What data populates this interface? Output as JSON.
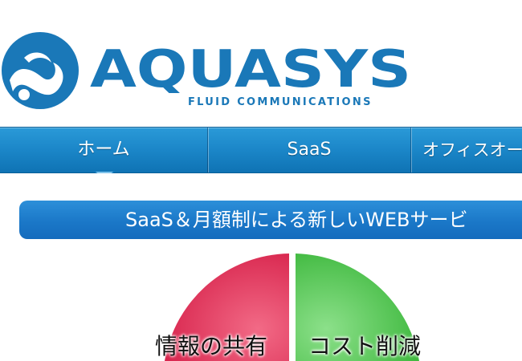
{
  "brand": {
    "name": "AQUASYS",
    "tagline": "FLUID COMMUNICATIONS"
  },
  "nav": {
    "items": [
      {
        "label": "ホーム"
      },
      {
        "label": "SaaS"
      },
      {
        "label": "オフィスオート"
      }
    ]
  },
  "banner": {
    "text": "SaaS＆月額制による新しいWEBサービ"
  },
  "wheel": {
    "segments": [
      {
        "label": "情報の共有",
        "color": "#e0284f"
      },
      {
        "label": "コスト削減",
        "color": "#3cbb3c"
      }
    ]
  },
  "colors": {
    "brand": "#1a78b8",
    "nav": "#1b86c8",
    "banner": "#1b78c8"
  }
}
